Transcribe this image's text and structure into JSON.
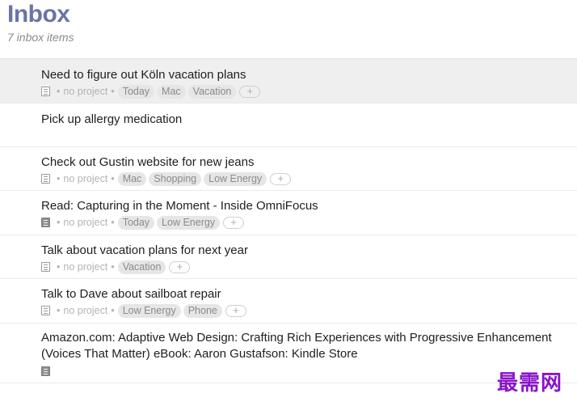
{
  "header": {
    "title": "Inbox",
    "subtitle": "7 inbox items"
  },
  "meta_labels": {
    "no_project": "no project",
    "dot": "•",
    "add": "+"
  },
  "tasks": [
    {
      "title": "Need to figure out Köln vacation plans",
      "tags": [
        "Today",
        "Mac",
        "Vacation"
      ],
      "selected": true
    },
    {
      "title": "Pick up allergy medication",
      "tags": []
    },
    {
      "title": "Check out Gustin website for new jeans",
      "tags": [
        "Mac",
        "Shopping",
        "Low Energy"
      ]
    },
    {
      "title": "Read: Capturing in the Moment - Inside OmniFocus",
      "tags": [
        "Today",
        "Low Energy"
      ],
      "has_note": true
    },
    {
      "title": "Talk about vacation plans for next year",
      "tags": [
        "Vacation"
      ]
    },
    {
      "title": "Talk to Dave about sailboat repair",
      "tags": [
        "Low Energy",
        "Phone"
      ]
    },
    {
      "title": "Amazon.com: Adaptive Web Design: Crafting Rich Experiences with Progressive Enhancement (Voices That Matter) eBook: Aaron Gustafson: Kindle Store",
      "tags": [],
      "has_note": true
    }
  ],
  "watermark": "最需网",
  "colors": {
    "title": "#6b74a6",
    "watermark": "#8a14c9",
    "selected_row": "#efefef"
  }
}
